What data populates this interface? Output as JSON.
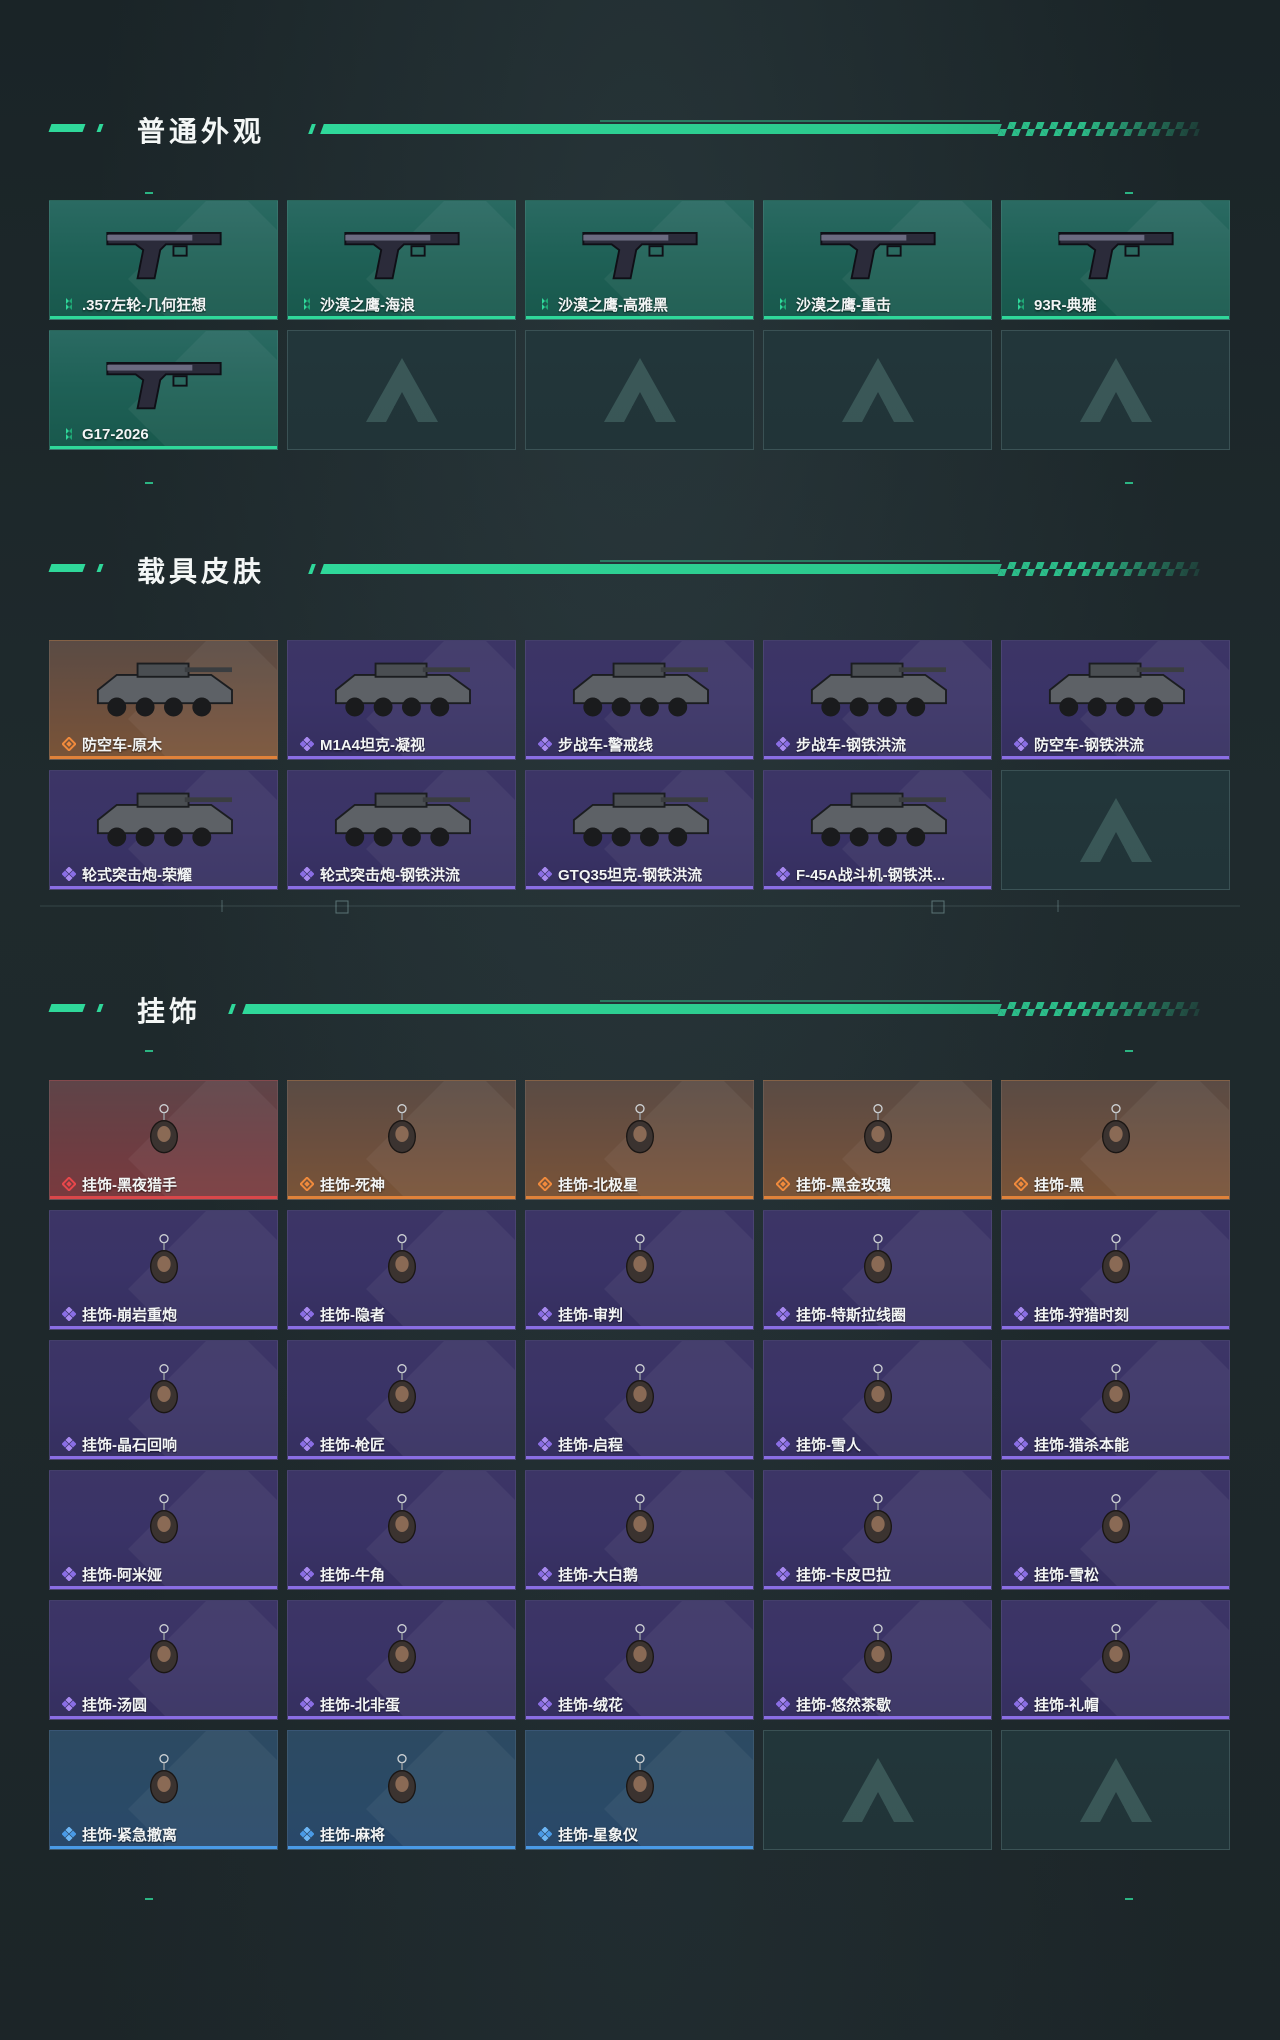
{
  "sections": {
    "weapon": {
      "title": "普通外观",
      "items": [
        {
          "name": ".357左轮-几何狂想",
          "rarity": "green"
        },
        {
          "name": "沙漠之鹰-海浪",
          "rarity": "green"
        },
        {
          "name": "沙漠之鹰-高雅黑",
          "rarity": "green"
        },
        {
          "name": "沙漠之鹰-重击",
          "rarity": "green"
        },
        {
          "name": "93R-典雅",
          "rarity": "green"
        },
        {
          "name": "G17-2026",
          "rarity": "green"
        }
      ]
    },
    "vehicle": {
      "title": "载具皮肤",
      "items": [
        {
          "name": "防空车-原木",
          "rarity": "orange"
        },
        {
          "name": "M1A4坦克-凝视",
          "rarity": "purple"
        },
        {
          "name": "步战车-警戒线",
          "rarity": "purple"
        },
        {
          "name": "步战车-钢铁洪流",
          "rarity": "purple"
        },
        {
          "name": "防空车-钢铁洪流",
          "rarity": "purple"
        },
        {
          "name": "轮式突击炮-荣耀",
          "rarity": "purple"
        },
        {
          "name": "轮式突击炮-钢铁洪流",
          "rarity": "purple"
        },
        {
          "name": "GTQ35坦克-钢铁洪流",
          "rarity": "purple"
        },
        {
          "name": "F-45A战斗机-钢铁洪...",
          "rarity": "purple"
        }
      ]
    },
    "charm": {
      "title": "挂饰",
      "items": [
        {
          "name": "挂饰-黑夜猎手",
          "rarity": "red"
        },
        {
          "name": "挂饰-死神",
          "rarity": "orange"
        },
        {
          "name": "挂饰-北极星",
          "rarity": "orange"
        },
        {
          "name": "挂饰-黑金玫瑰",
          "rarity": "orange"
        },
        {
          "name": "挂饰-黑",
          "rarity": "orange"
        },
        {
          "name": "挂饰-崩岩重炮",
          "rarity": "purple"
        },
        {
          "name": "挂饰-隐者",
          "rarity": "purple"
        },
        {
          "name": "挂饰-审判",
          "rarity": "purple"
        },
        {
          "name": "挂饰-特斯拉线圈",
          "rarity": "purple"
        },
        {
          "name": "挂饰-狩猎时刻",
          "rarity": "purple"
        },
        {
          "name": "挂饰-晶石回响",
          "rarity": "purple"
        },
        {
          "name": "挂饰-枪匠",
          "rarity": "purple"
        },
        {
          "name": "挂饰-启程",
          "rarity": "purple"
        },
        {
          "name": "挂饰-雪人",
          "rarity": "purple"
        },
        {
          "name": "挂饰-猎杀本能",
          "rarity": "purple"
        },
        {
          "name": "挂饰-阿米娅",
          "rarity": "purple"
        },
        {
          "name": "挂饰-牛角",
          "rarity": "purple"
        },
        {
          "name": "挂饰-大白鹅",
          "rarity": "purple"
        },
        {
          "name": "挂饰-卡皮巴拉",
          "rarity": "purple"
        },
        {
          "name": "挂饰-雪松",
          "rarity": "purple"
        },
        {
          "name": "挂饰-汤圆",
          "rarity": "purple"
        },
        {
          "name": "挂饰-北非蛋",
          "rarity": "purple"
        },
        {
          "name": "挂饰-绒花",
          "rarity": "purple"
        },
        {
          "name": "挂饰-悠然茶歇",
          "rarity": "purple"
        },
        {
          "name": "挂饰-礼帽",
          "rarity": "purple"
        },
        {
          "name": "挂饰-紧急撤离",
          "rarity": "blue"
        },
        {
          "name": "挂饰-麻将",
          "rarity": "blue"
        },
        {
          "name": "挂饰-星象仪",
          "rarity": "blue"
        }
      ]
    }
  },
  "colors": {
    "accent": "#2fd89a",
    "green_card": "#1f6157",
    "purple_card": "#3a3367",
    "orange_card": "#6c4f3e",
    "red_card": "#6d3d42",
    "blue_card": "#2a4a66",
    "empty_card": "#22363a"
  },
  "icons": {
    "green": "tick-rarity-icon",
    "purple": "diamond-cluster-rarity-icon",
    "orange": "diamond-rarity-icon",
    "red": "diamond-rarity-icon",
    "blue": "diamond-cluster-rarity-icon",
    "empty": "delta-logo-icon"
  }
}
